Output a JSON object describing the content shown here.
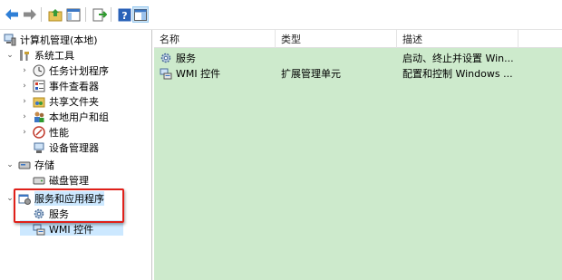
{
  "toolbar": {
    "buttons": [
      {
        "name": "back-arrow-icon"
      },
      {
        "name": "forward-arrow-icon"
      },
      {
        "name": "up-folder-icon"
      },
      {
        "name": "show-hide-console-tree-icon"
      },
      {
        "name": "export-list-icon"
      },
      {
        "name": "help-icon",
        "glyph": "?"
      },
      {
        "name": "action-pane-icon"
      }
    ]
  },
  "tree": {
    "root": "计算机管理(本地)",
    "system_tools": "系统工具",
    "task_scheduler": "任务计划程序",
    "event_viewer": "事件查看器",
    "shared_folders": "共享文件夹",
    "local_users": "本地用户和组",
    "performance": "性能",
    "device_manager": "设备管理器",
    "storage": "存储",
    "disk_management": "磁盘管理",
    "services_apps": "服务和应用程序",
    "services": "服务",
    "wmi": "WMI 控件"
  },
  "list": {
    "columns": [
      "名称",
      "类型",
      "描述"
    ],
    "rows": [
      {
        "name": "服务",
        "type": "",
        "desc": "启动、终止并设置 Win..."
      },
      {
        "name": "WMI 控件",
        "type": "扩展管理单元",
        "desc": "配置和控制 Windows ..."
      }
    ]
  },
  "colors": {
    "list_background": "#cdeacc",
    "highlight_border": "#e0201a",
    "selection": "#cce8ff"
  }
}
